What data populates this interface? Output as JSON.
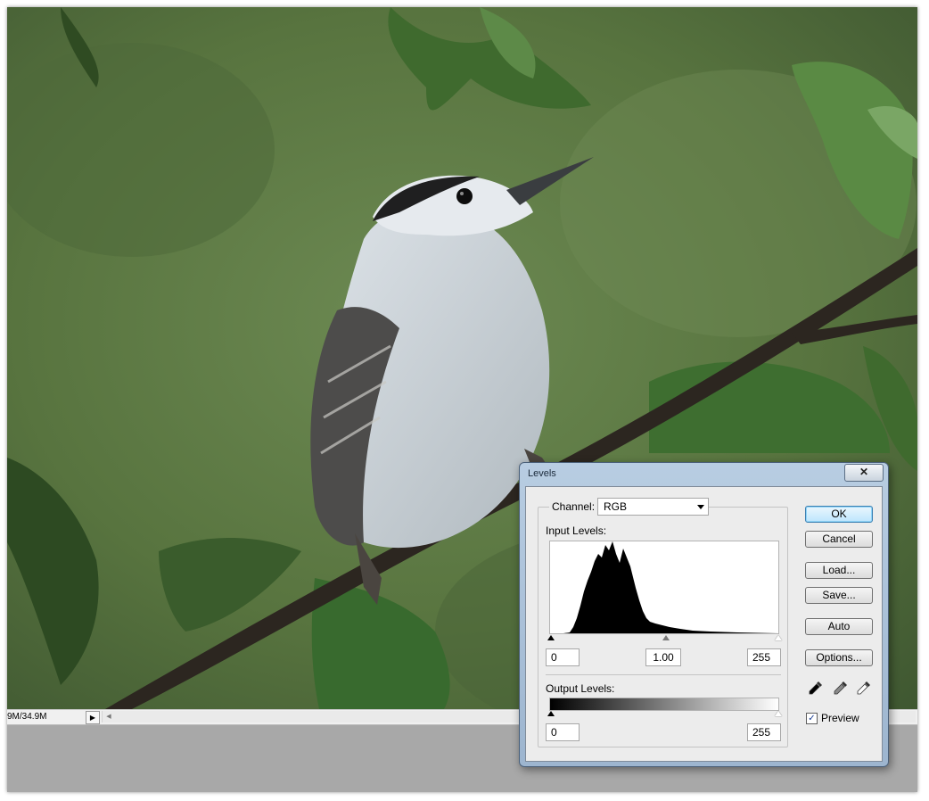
{
  "status_bar": {
    "doc_size": "9M/34.9M",
    "menu_arrow_glyph": "▶",
    "scroll_left_glyph": "◀"
  },
  "photo": {
    "subject_icon": "bird-photo",
    "background_color": "#5d7a45"
  },
  "dialog": {
    "title": "Levels",
    "close_glyph": "✕",
    "channel_label": "Channel:",
    "channel_value": "RGB",
    "input_levels_label": "Input Levels:",
    "input_black": "0",
    "input_gamma": "1.00",
    "input_white": "255",
    "output_levels_label": "Output Levels:",
    "output_black": "0",
    "output_white": "255",
    "buttons": {
      "ok": "OK",
      "cancel": "Cancel",
      "load": "Load...",
      "save": "Save...",
      "auto": "Auto",
      "options": "Options..."
    },
    "preview_label": "Preview",
    "preview_checked": true,
    "check_glyph": "✓",
    "eyedroppers": [
      "black-point-eyedropper-icon",
      "gray-point-eyedropper-icon",
      "white-point-eyedropper-icon"
    ],
    "accent_color": "#3c7fb1"
  }
}
